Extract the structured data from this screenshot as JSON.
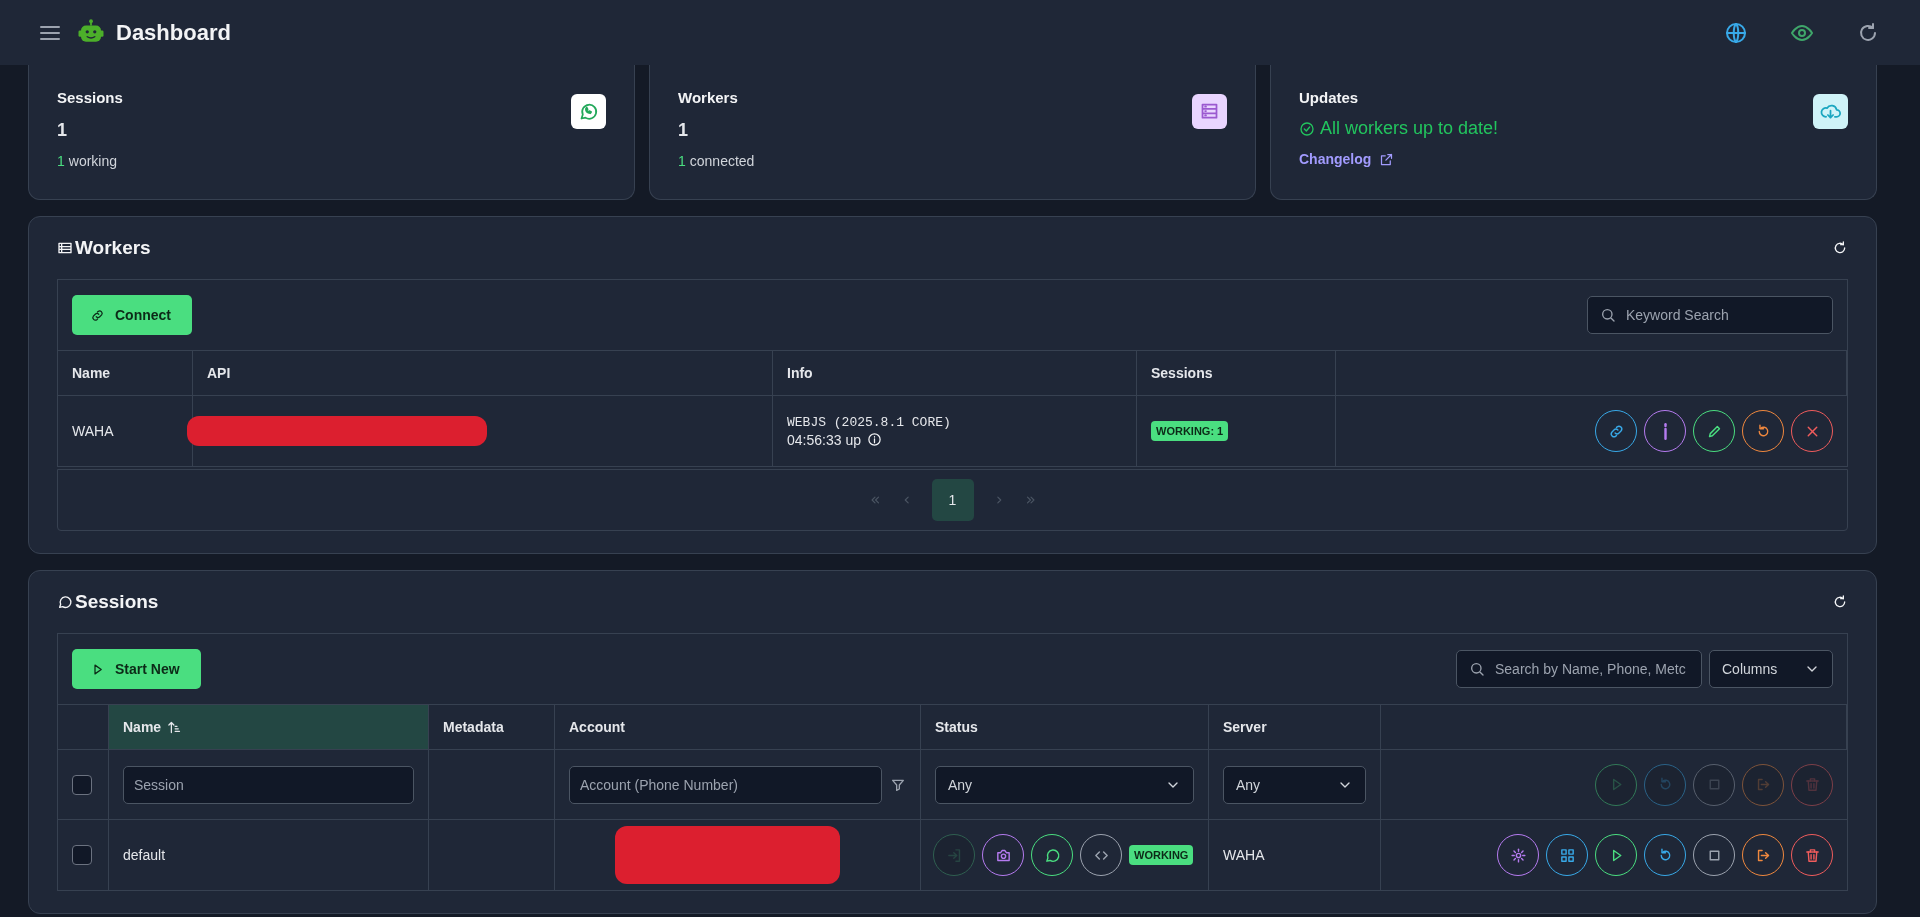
{
  "header": {
    "title": "Dashboard",
    "actions": [
      {
        "kind": "globe"
      },
      {
        "kind": "eye"
      },
      {
        "kind": "refresh"
      }
    ]
  },
  "stats": [
    {
      "kind": "sessions",
      "title": "Sessions",
      "value": "1",
      "count": "1",
      "note": "working"
    },
    {
      "kind": "workers",
      "title": "Workers",
      "value": "1",
      "count": "1",
      "note": "connected"
    },
    {
      "kind": "updates",
      "title": "Updates",
      "status": "All workers up to date!",
      "link": "Changelog"
    }
  ],
  "workers": {
    "title": "Workers",
    "connect_button": "Connect",
    "search": {
      "placeholder": "Keyword Search"
    },
    "columns": [
      "Name",
      "API",
      "Info",
      "Sessions"
    ],
    "rows": [
      {
        "name": "WAHA",
        "api_redacted": true,
        "engine": "WEBJS (2025.8.1 CORE)",
        "uptime": "04:56:33 up",
        "sessions_badge": "WORKING: 1",
        "actions": [
          {
            "kind": "link",
            "color": "#38a9e8"
          },
          {
            "kind": "info",
            "color": "#b57bf0"
          },
          {
            "kind": "edit",
            "color": "#4ade80"
          },
          {
            "kind": "restart",
            "color": "#f0883e"
          },
          {
            "kind": "close",
            "color": "#f05c5c"
          }
        ]
      }
    ],
    "pages": [
      {
        "label": "1",
        "selected": true
      }
    ]
  },
  "sessions": {
    "title": "Sessions",
    "start_button": "Start New",
    "search": {
      "placeholder": "Search by Name, Phone, Metc"
    },
    "columns_button": "Columns",
    "columns": [
      {
        "label": "Name",
        "sorted": true
      },
      {
        "label": "Metadata",
        "sorted": false
      },
      {
        "label": "Account",
        "sorted": false
      },
      {
        "label": "Status",
        "sorted": false
      },
      {
        "label": "Server",
        "sorted": false
      }
    ],
    "filters": {
      "checked": false,
      "session": {
        "placeholder": "Session"
      },
      "account": {
        "placeholder": "Account (Phone Number)"
      },
      "status": {
        "value": "Any"
      },
      "server": {
        "value": "Any"
      },
      "actions": [
        {
          "kind": "play",
          "color": "#327958",
          "disabled": true
        },
        {
          "kind": "restart",
          "color": "#2a6287",
          "disabled": true
        },
        {
          "kind": "stop",
          "color": "#575f6d",
          "disabled": true
        },
        {
          "kind": "logout",
          "color": "#7d533a",
          "disabled": true
        },
        {
          "kind": "trash",
          "color": "#7d3f48",
          "disabled": true
        }
      ]
    },
    "rows": [
      {
        "checked": false,
        "name": "default",
        "account_redacted": true,
        "status": "WORKING",
        "server": "WAHA",
        "status_actions": [
          {
            "kind": "login",
            "color": "#2f5f50",
            "disabled": true
          },
          {
            "kind": "camera",
            "color": "#b57bf0",
            "disabled": false
          },
          {
            "kind": "chat",
            "color": "#4ade80",
            "disabled": false
          },
          {
            "kind": "code",
            "color": "#9ca3af",
            "disabled": false
          }
        ],
        "actions": [
          {
            "kind": "gear",
            "color": "#b57bf0",
            "disabled": false
          },
          {
            "kind": "grid",
            "color": "#38a9e8",
            "disabled": false
          },
          {
            "kind": "play",
            "color": "#4ade80",
            "disabled": false
          },
          {
            "kind": "restart",
            "color": "#38a9e8",
            "disabled": false
          },
          {
            "kind": "stop",
            "color": "#9ca3af",
            "disabled": false
          },
          {
            "kind": "logout",
            "color": "#f0883e",
            "disabled": false
          },
          {
            "kind": "trash",
            "color": "#f05c5c",
            "disabled": false
          }
        ]
      }
    ]
  }
}
